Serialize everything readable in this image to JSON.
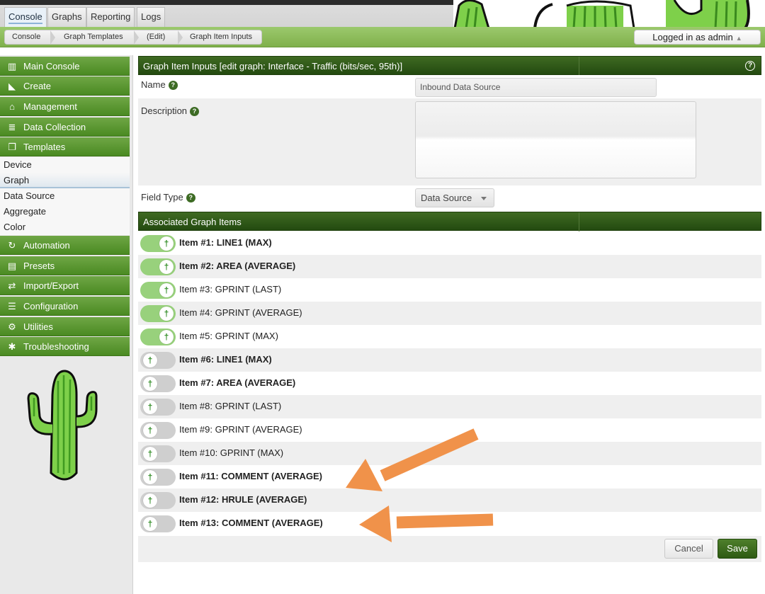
{
  "top_tabs": [
    {
      "label": "Console",
      "active": true
    },
    {
      "label": "Graphs",
      "active": false
    },
    {
      "label": "Reporting",
      "active": false
    },
    {
      "label": "Logs",
      "active": false
    }
  ],
  "breadcrumb": [
    "Console",
    "Graph Templates",
    "(Edit)",
    "Graph Item Inputs"
  ],
  "user": {
    "login_label": "Logged in as admin"
  },
  "sidebar": {
    "menu": [
      {
        "label": "Main Console",
        "icon": "map-icon"
      },
      {
        "label": "Create",
        "icon": "chart-icon"
      },
      {
        "label": "Management",
        "icon": "home-icon"
      },
      {
        "label": "Data Collection",
        "icon": "database-icon"
      },
      {
        "label": "Templates",
        "icon": "copy-icon"
      }
    ],
    "submenu": [
      {
        "label": "Device",
        "selected": false
      },
      {
        "label": "Graph",
        "selected": true
      },
      {
        "label": "Data Source",
        "selected": false
      },
      {
        "label": "Aggregate",
        "selected": false
      },
      {
        "label": "Color",
        "selected": false
      }
    ],
    "menu2": [
      {
        "label": "Automation",
        "icon": "refresh-icon"
      },
      {
        "label": "Presets",
        "icon": "archive-icon"
      },
      {
        "label": "Import/Export",
        "icon": "exchange-icon"
      },
      {
        "label": "Configuration",
        "icon": "sliders-icon"
      },
      {
        "label": "Utilities",
        "icon": "cogs-icon"
      },
      {
        "label": "Troubleshooting",
        "icon": "bug-icon"
      }
    ]
  },
  "form": {
    "title": "Graph Item Inputs [edit graph: Interface - Traffic (bits/sec, 95th)]",
    "name_label": "Name",
    "name_value": "Inbound Data Source",
    "description_label": "Description",
    "description_value": "",
    "field_type_label": "Field Type",
    "field_type_value": "Data Source"
  },
  "associated": {
    "title": "Associated Graph Items",
    "items": [
      {
        "label": "Item #1: LINE1 (MAX)",
        "on": true,
        "bold": true
      },
      {
        "label": "Item #2: AREA (AVERAGE)",
        "on": true,
        "bold": true
      },
      {
        "label": "Item #3: GPRINT (LAST)",
        "on": true,
        "bold": false
      },
      {
        "label": "Item #4: GPRINT (AVERAGE)",
        "on": true,
        "bold": false
      },
      {
        "label": "Item #5: GPRINT (MAX)",
        "on": true,
        "bold": false
      },
      {
        "label": "Item #6: LINE1 (MAX)",
        "on": false,
        "bold": true
      },
      {
        "label": "Item #7: AREA (AVERAGE)",
        "on": false,
        "bold": true
      },
      {
        "label": "Item #8: GPRINT (LAST)",
        "on": false,
        "bold": false
      },
      {
        "label": "Item #9: GPRINT (AVERAGE)",
        "on": false,
        "bold": false
      },
      {
        "label": "Item #10: GPRINT (MAX)",
        "on": false,
        "bold": false
      },
      {
        "label": "Item #11: COMMENT (AVERAGE)",
        "on": false,
        "bold": true
      },
      {
        "label": "Item #12: HRULE (AVERAGE)",
        "on": false,
        "bold": true
      },
      {
        "label": "Item #13: COMMENT (AVERAGE)",
        "on": false,
        "bold": true
      }
    ]
  },
  "buttons": {
    "cancel": "Cancel",
    "save": "Save"
  },
  "colors": {
    "menu_green": "#4a8a22",
    "header_green": "#2f5a18",
    "toggle_on": "#98d17c",
    "toggle_off": "#cfcfcf",
    "annotation_arrow": "#f0924a"
  }
}
